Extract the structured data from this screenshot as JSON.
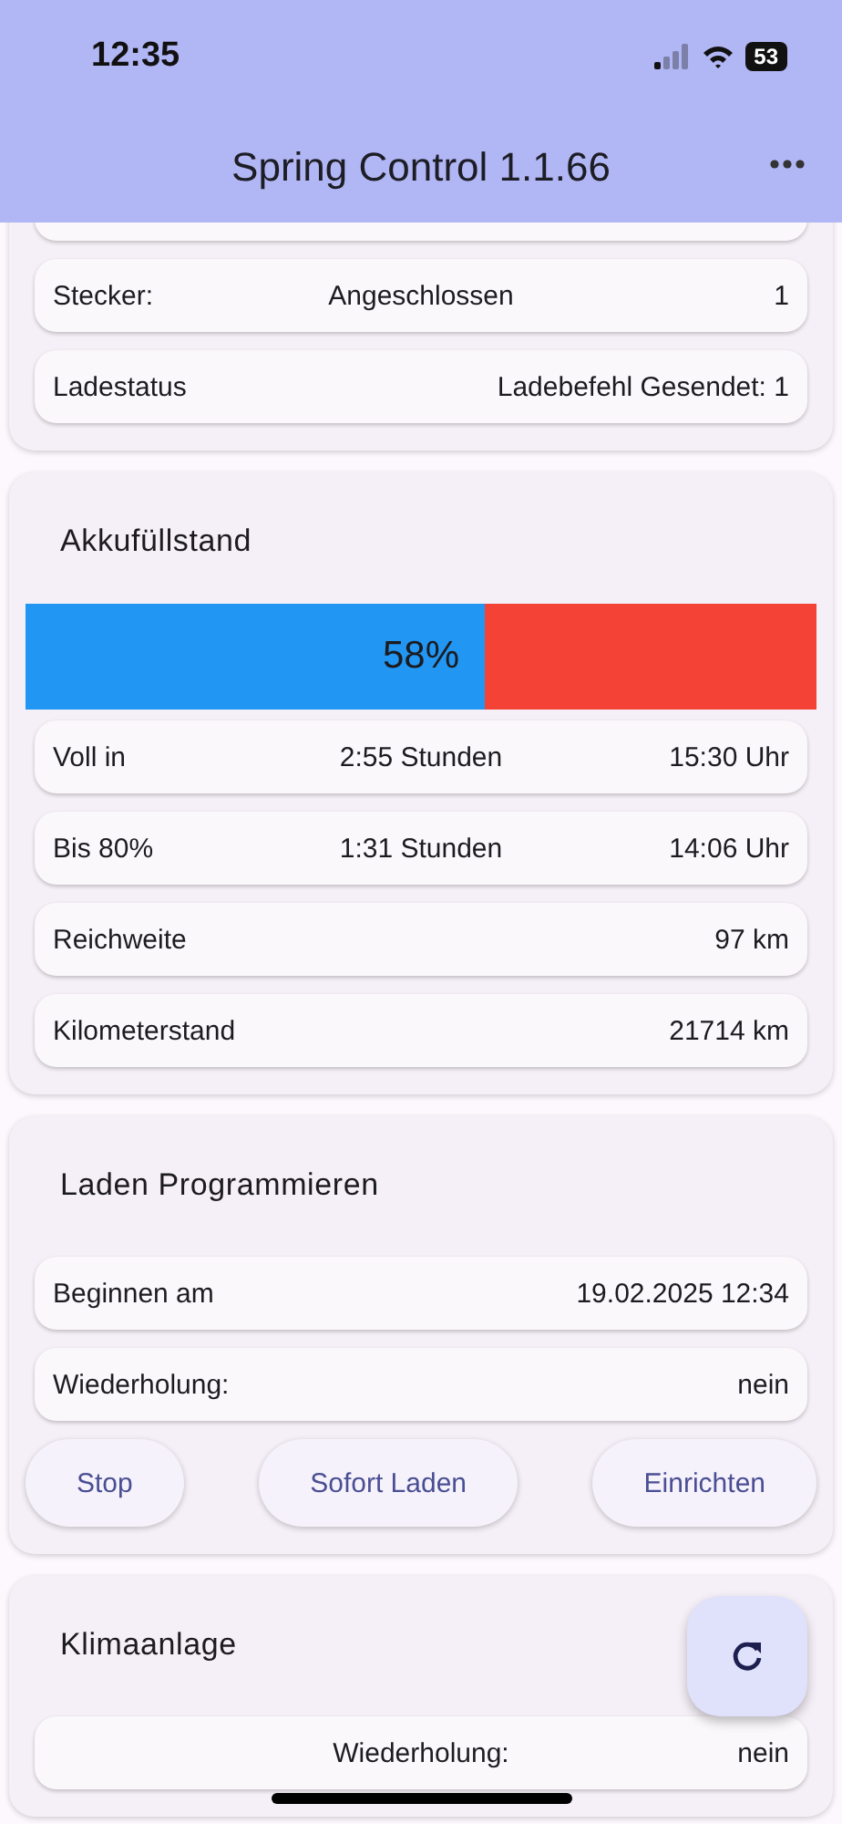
{
  "status_bar": {
    "time": "12:35",
    "battery": "53"
  },
  "app_bar": {
    "title": "Spring Control 1.1.66"
  },
  "connection_card": {
    "rows": [
      {
        "label": "",
        "middle": "",
        "value": ""
      },
      {
        "label": "Stecker:",
        "middle": "Angeschlossen",
        "value": "1"
      },
      {
        "label": "Ladestatus",
        "middle": "",
        "value": "Ladebefehl Gesendet: 1"
      }
    ]
  },
  "battery_card": {
    "title": "Akkufüllstand",
    "charge": {
      "level": 0.58,
      "reading": "58%"
    },
    "rows": [
      {
        "label": "Voll in",
        "middle": "2:55 Stunden",
        "value": "15:30 Uhr"
      },
      {
        "label": "Bis 80%",
        "middle": "1:31 Stunden",
        "value": "14:06 Uhr"
      },
      {
        "label": "Reichweite",
        "middle": "",
        "value": "97 km"
      },
      {
        "label": "Kilometerstand",
        "middle": "",
        "value": "21714 km"
      }
    ]
  },
  "schedule_card": {
    "title": "Laden Programmieren",
    "rows": [
      {
        "label": "Beginnen am",
        "middle": "",
        "value": "19.02.2025 12:34"
      },
      {
        "label": "Wiederholung:",
        "middle": "",
        "value": "nein"
      }
    ],
    "buttons": [
      "Stop",
      "Sofort Laden",
      "Einrichten"
    ]
  },
  "climate_card": {
    "title": "Klimaanlage",
    "rows": [
      {
        "label": "",
        "middle": "Wiederholung:",
        "value": "nein"
      }
    ]
  }
}
